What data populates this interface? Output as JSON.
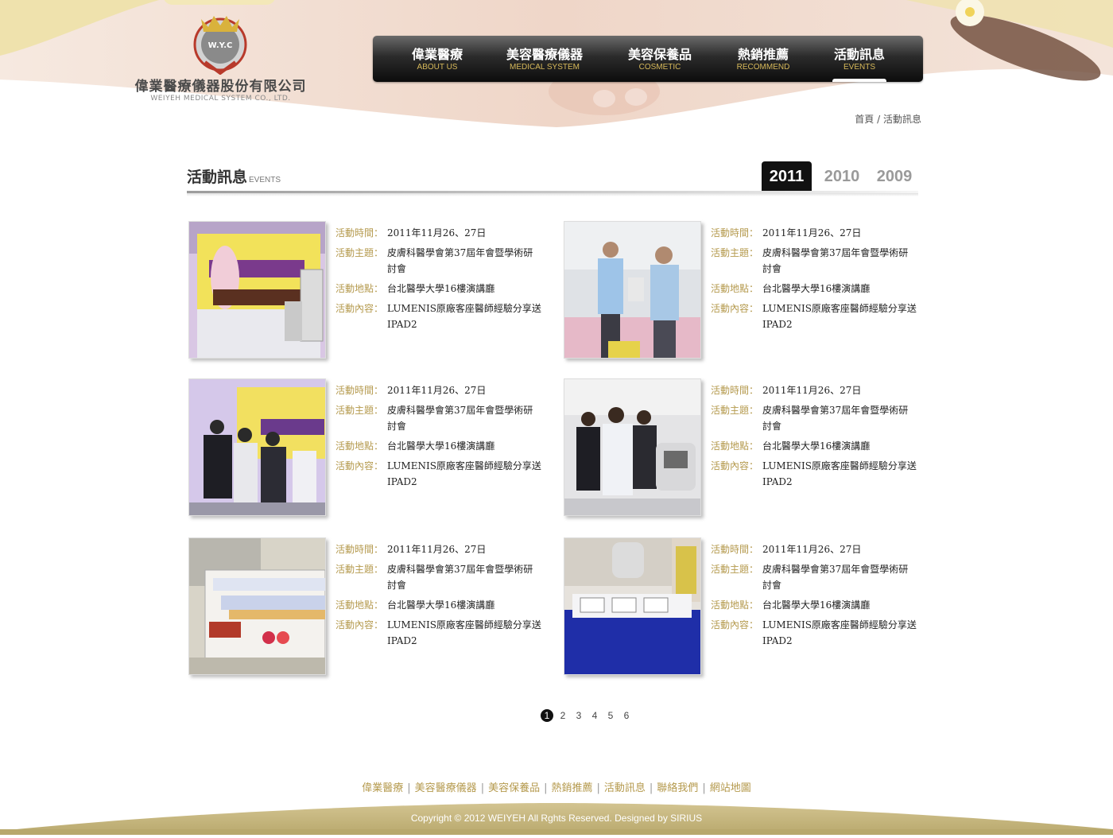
{
  "brand": {
    "emblem_text": "W.Y.C",
    "name_zh": "偉業醫療儀器股份有限公司",
    "name_en": "WEIYEH MEDICAL SYSTEM CO., LTD."
  },
  "nav": {
    "items": [
      {
        "zh": "偉業醫療",
        "en": "ABOUT US"
      },
      {
        "zh": "美容醫療儀器",
        "en": "MEDICAL SYSTEM"
      },
      {
        "zh": "美容保養品",
        "en": "COSMETIC"
      },
      {
        "zh": "熱銷推薦",
        "en": "RECOMMEND"
      },
      {
        "zh": "活動訊息",
        "en": "EVENTS"
      }
    ],
    "active_index": 4
  },
  "breadcrumb": {
    "home": "首頁",
    "sep": "/",
    "current": "活動訊息"
  },
  "section": {
    "title_zh": "活動訊息",
    "title_en": "EVENTS"
  },
  "years": [
    "2011",
    "2010",
    "2009"
  ],
  "labels": {
    "time": "活動時間：",
    "topic": "活動主題：",
    "place": "活動地點：",
    "content": "活動內容："
  },
  "events": [
    {
      "time": "2011年11月26、27日",
      "topic": "皮膚科醫學會第37屆年會暨學術研討會",
      "place": "台北醫學大學16樓演講廳",
      "content": "LUMENIS原廠客座醫師經驗分享送IPAD2"
    },
    {
      "time": "2011年11月26、27日",
      "topic": "皮膚科醫學會第37屆年會暨學術研討會",
      "place": "台北醫學大學16樓演講廳",
      "content": "LUMENIS原廠客座醫師經驗分享送IPAD2"
    },
    {
      "time": "2011年11月26、27日",
      "topic": "皮膚科醫學會第37屆年會暨學術研討會",
      "place": "台北醫學大學16樓演講廳",
      "content": "LUMENIS原廠客座醫師經驗分享送IPAD2"
    },
    {
      "time": "2011年11月26、27日",
      "topic": "皮膚科醫學會第37屆年會暨學術研討會",
      "place": "台北醫學大學16樓演講廳",
      "content": "LUMENIS原廠客座醫師經驗分享送IPAD2"
    },
    {
      "time": "2011年11月26、27日",
      "topic": "皮膚科醫學會第37屆年會暨學術研討會",
      "place": "台北醫學大學16樓演講廳",
      "content": "LUMENIS原廠客座醫師經驗分享送IPAD2"
    },
    {
      "time": "2011年11月26、27日",
      "topic": "皮膚科醫學會第37屆年會暨學術研討會",
      "place": "台北醫學大學16樓演講廳",
      "content": "LUMENIS原廠客座醫師經驗分享送IPAD2"
    }
  ],
  "pagination": {
    "pages": [
      "1",
      "2",
      "3",
      "4",
      "5",
      "6"
    ],
    "current": "1"
  },
  "footer": {
    "links": [
      "偉業醫療",
      "美容醫療儀器",
      "美容保養品",
      "熱銷推薦",
      "活動訊息",
      "聯絡我們",
      "網站地圖"
    ],
    "separator": "|",
    "copyright": "Copyright © 2012 WEIYEH All Rghts Reserved. Designed by SIRIUS"
  },
  "colors": {
    "accent_gold": "#b59a4e",
    "nav_en_gold": "#d7b95a",
    "footer_band": "#c2b27a",
    "dark": "#111111"
  }
}
